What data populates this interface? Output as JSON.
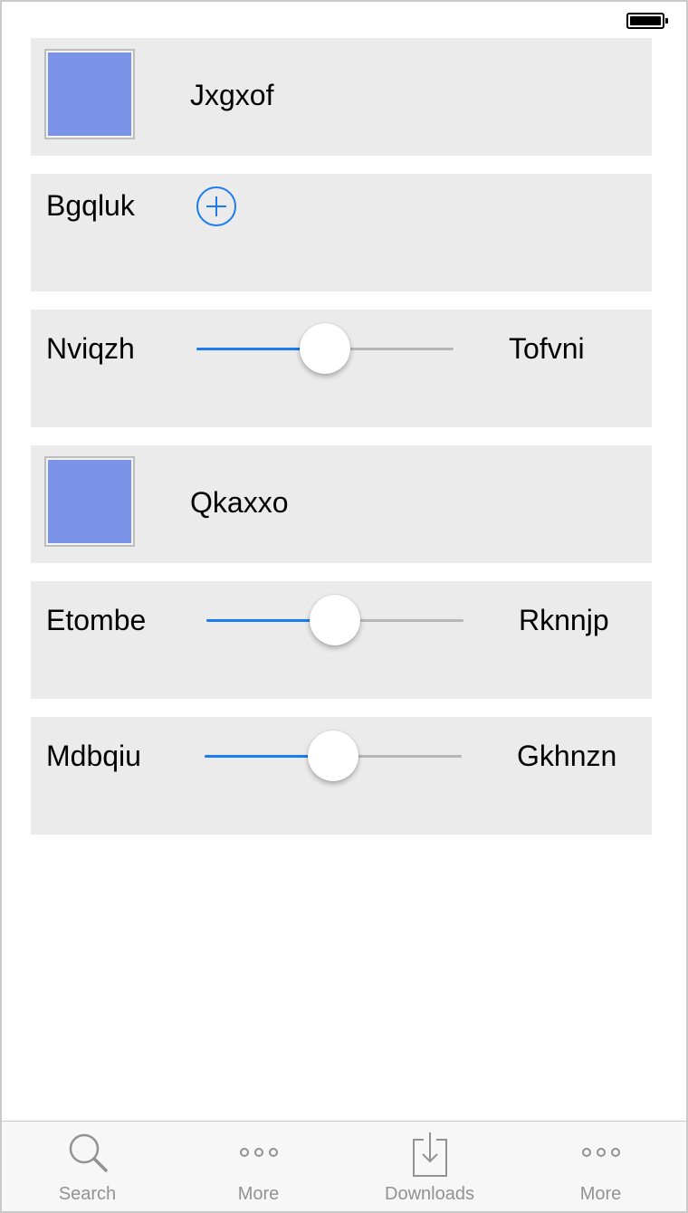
{
  "status_bar": {
    "battery_icon": "battery-full-icon"
  },
  "rows": [
    {
      "type": "image_label",
      "label": "Jxgxof",
      "swatch_color": "#7b93e6"
    },
    {
      "type": "button_label",
      "label": "Bgqluk",
      "icon": "add-circle-icon"
    },
    {
      "type": "slider",
      "left_label": "Nviqzh",
      "right_label": "Tofvni",
      "value": 0.5
    },
    {
      "type": "image_label",
      "label": "Qkaxxo",
      "swatch_color": "#7b93e6"
    },
    {
      "type": "slider",
      "left_label": "Etombe",
      "right_label": "Rknnjp",
      "value": 0.5
    },
    {
      "type": "slider",
      "left_label": "Mdbqiu",
      "right_label": "Gkhnzn",
      "value": 0.5
    }
  ],
  "tab_bar": {
    "tabs": [
      {
        "label": "Search",
        "icon": "search-icon"
      },
      {
        "label": "More",
        "icon": "more-icon"
      },
      {
        "label": "Downloads",
        "icon": "downloads-icon"
      },
      {
        "label": "More",
        "icon": "more-icon"
      }
    ]
  },
  "colors": {
    "accent": "#1a7cf0",
    "card_background": "#ebebeb",
    "tab_inactive": "#929292"
  }
}
